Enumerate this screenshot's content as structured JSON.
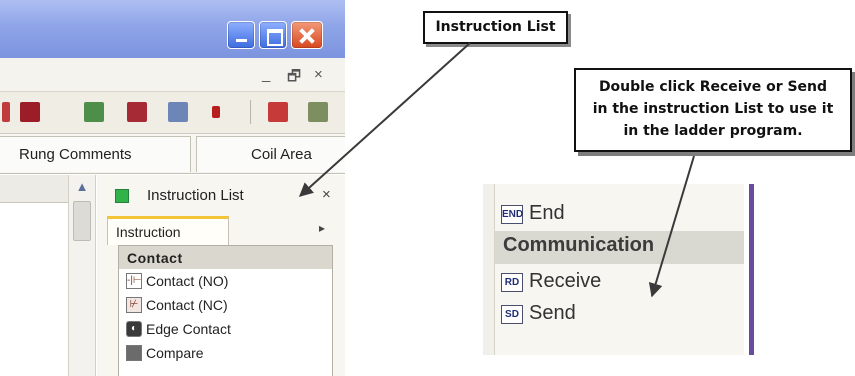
{
  "window": {
    "mdi_min": "_",
    "mdi_restore": "🗗",
    "mdi_close": "×"
  },
  "tabs": {
    "rung_comments": "Rung Comments",
    "coil_area": "Coil Area"
  },
  "instruction_panel": {
    "title": "Instruction List",
    "close": "×",
    "tab_label": "Instruction",
    "tab_menu_arrow": "▸",
    "category": "Contact",
    "items": [
      {
        "label": "Contact (NO)",
        "icon": "contact-no-icon",
        "icon_text": "-|⊢"
      },
      {
        "label": "Contact (NC)",
        "icon": "contact-nc-icon",
        "icon_text": "⊬"
      },
      {
        "label": "Edge Contact",
        "icon": "edge-contact-icon",
        "icon_text": "◐"
      },
      {
        "label": "Compare",
        "icon": "compare-icon",
        "icon_text": ""
      }
    ]
  },
  "detail_list": {
    "end": {
      "label": "End",
      "icon_text": "END"
    },
    "category": "Communication",
    "receive": {
      "label": "Receive",
      "icon_text": "RD"
    },
    "send": {
      "label": "Send",
      "icon_text": "SD"
    }
  },
  "callouts": {
    "instruction_list": "Instruction List",
    "double_click_lines": [
      "Double click Receive or Send",
      "in the instruction List to use it",
      "in the ladder program."
    ]
  },
  "colors": {
    "titlebar": "#8fa5e8",
    "close_button": "#d7471f",
    "panel_active_dot": "#34b24a",
    "tab_highlight": "#f3c338",
    "purple_strip": "#6a4c9c",
    "arrow": "#3a3a3a"
  }
}
